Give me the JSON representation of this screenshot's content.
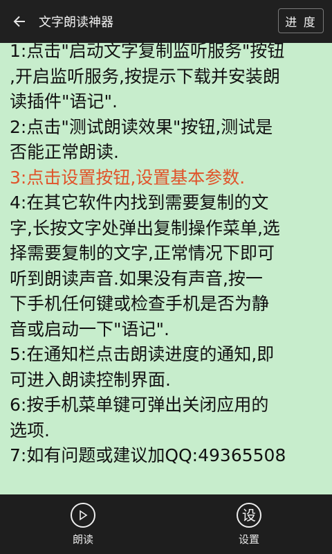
{
  "header": {
    "title": "文字朗读神器",
    "back_icon": "arrow-left-icon",
    "progress_button": "进 度"
  },
  "instructions": [
    "1:点击\"启动文字复制监听服务\"按钮",
    ",开启监听服务,按提示下载并安装朗",
    "读插件\"语记\".",
    "2:点击\"测试朗读效果\"按钮,测试是",
    "否能正常朗读.",
    "3:点击设置按钮,设置基本参数.",
    "4:在其它软件内找到需要复制的文",
    "字,长按文字处弹出复制操作菜单,选",
    "择需要复制的文字,正常情况下即可",
    "听到朗读声音.如果没有声音,按一",
    "下手机任何键或检查手机是否为静",
    "音或启动一下\"语记\".",
    "5:在通知栏点击朗读进度的通知,即",
    "可进入朗读控制界面.",
    "6:按手机菜单键可弹出关闭应用的",
    "选项.",
    "7:如有问题或建议加QQ:49365508"
  ],
  "highlight_color": "#e0532a",
  "background_color": "#c7edcc",
  "bottom_nav": {
    "read": {
      "label": "朗读",
      "icon": "play-circle-icon"
    },
    "settings": {
      "label": "设置",
      "icon_text": "设",
      "icon": "settings-text-icon"
    }
  }
}
